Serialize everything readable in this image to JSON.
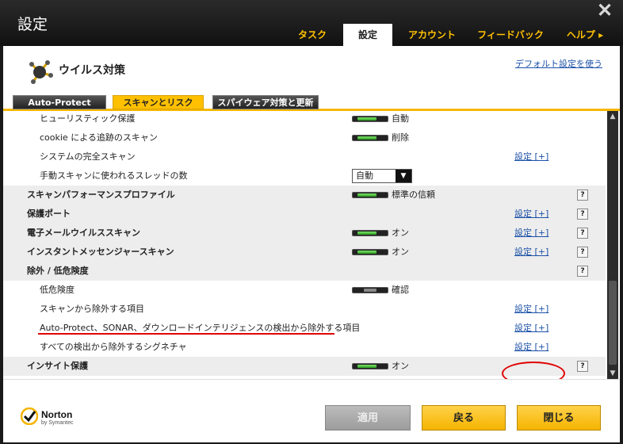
{
  "app": {
    "title": "設定"
  },
  "nav": {
    "tabs": [
      {
        "label": "タスク"
      },
      {
        "label": "設定"
      },
      {
        "label": "アカウント"
      },
      {
        "label": "フィードバック"
      },
      {
        "label": "ヘルプ ▸"
      }
    ]
  },
  "section": {
    "title": "ウイルス対策",
    "default_link": "デフォルト設定を使う"
  },
  "subtabs": [
    {
      "label": "Auto-Protect"
    },
    {
      "label": "スキャンとリスク"
    },
    {
      "label": "スパイウェア対策と更新"
    }
  ],
  "rows": [
    {
      "label": "ヒューリスティック保護",
      "status": "自動"
    },
    {
      "label": "cookie による追跡のスキャン",
      "status": "削除"
    },
    {
      "label": "システムの完全スキャン",
      "link": "設定 [+]"
    },
    {
      "label": "手動スキャンに使われるスレッドの数",
      "dropdown": "自動"
    },
    {
      "label": "スキャンパフォーマンスプロファイル",
      "status": "標準の信頼",
      "help": "?"
    },
    {
      "label": "保護ポート",
      "link": "設定 [+]",
      "help": "?"
    },
    {
      "label": "電子メールウイルススキャン",
      "status": "オン",
      "link": "設定 [+]",
      "help": "?"
    },
    {
      "label": "インスタントメッセンジャースキャン",
      "status": "オン",
      "link": "設定 [+]",
      "help": "?"
    },
    {
      "label": "除外 / 低危険度",
      "help": "?"
    },
    {
      "label": "低危険度",
      "status": "確認"
    },
    {
      "label": "スキャンから除外する項目",
      "link": "設定 [+]"
    },
    {
      "label": "Auto-Protect、SONAR、ダウンロードインテリジェンスの検出から除外する項目",
      "link": "設定 [+]"
    },
    {
      "label": "すべての検出から除外するシグネチャ",
      "link": "設定 [+]"
    },
    {
      "label": "インサイト保護",
      "status": "オン",
      "help": "?"
    }
  ],
  "footer": {
    "logo_text": "Norton",
    "logo_sub": "by Symantec",
    "apply_label": "適用",
    "back_label": "戻る",
    "close_label": "閉じる"
  },
  "scrollbar": {
    "up_glyph": "▲",
    "down_glyph": "▼"
  },
  "colors": {
    "accent": "#ffc000",
    "link": "#1d52a8",
    "highlight": "#e00000"
  }
}
